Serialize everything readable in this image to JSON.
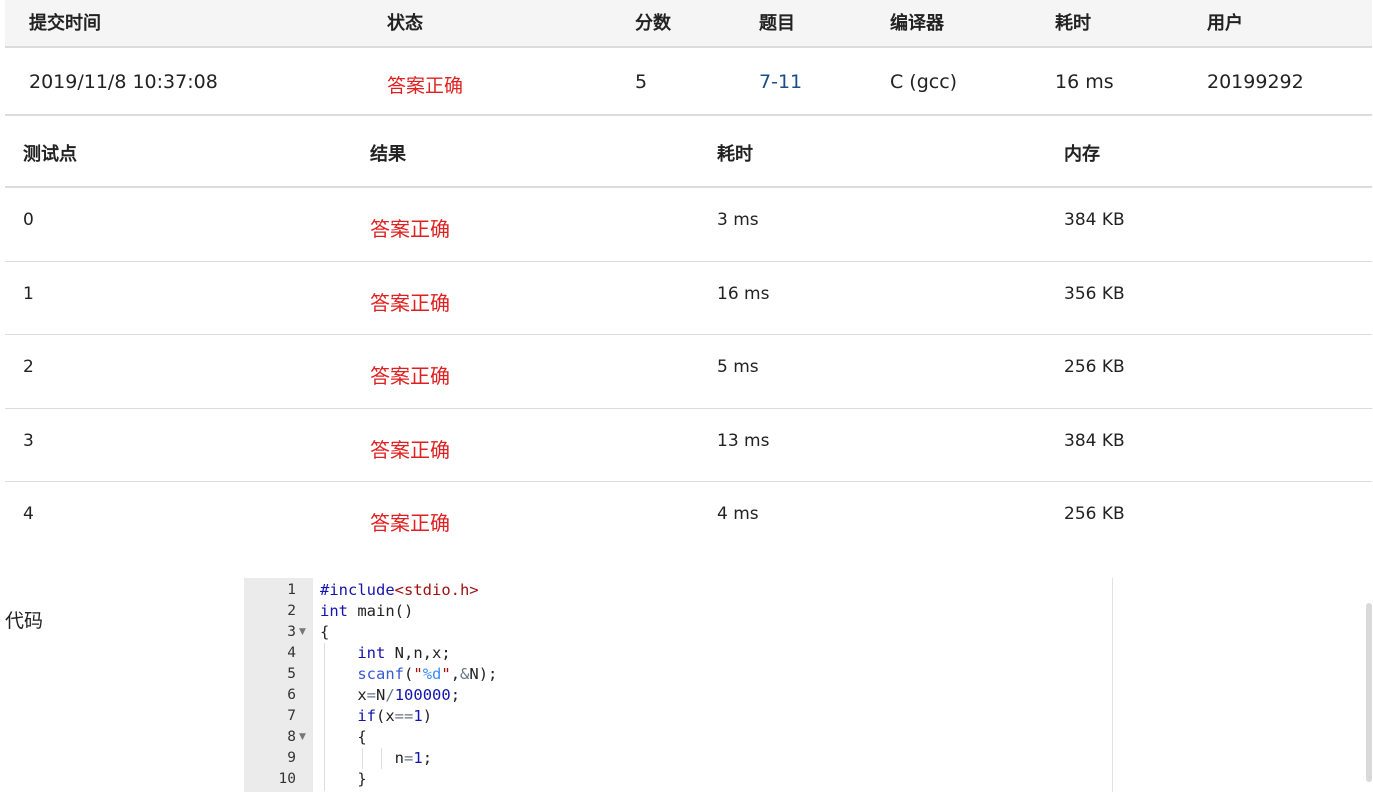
{
  "submission": {
    "headers": [
      "提交时间",
      "状态",
      "分数",
      "题目",
      "编译器",
      "耗时",
      "用户"
    ],
    "row": {
      "time": "2019/11/8 10:37:08",
      "status": "答案正确",
      "score": "5",
      "problem": "7-11",
      "compiler": "C (gcc)",
      "duration": "16 ms",
      "user": "20199292"
    }
  },
  "cases": {
    "headers": [
      "测试点",
      "结果",
      "耗时",
      "内存"
    ],
    "rows": [
      {
        "id": "0",
        "result": "答案正确",
        "time": "3 ms",
        "memory": "384 KB"
      },
      {
        "id": "1",
        "result": "答案正确",
        "time": "16 ms",
        "memory": "356 KB"
      },
      {
        "id": "2",
        "result": "答案正确",
        "time": "5 ms",
        "memory": "256 KB"
      },
      {
        "id": "3",
        "result": "答案正确",
        "time": "13 ms",
        "memory": "384 KB"
      },
      {
        "id": "4",
        "result": "答案正确",
        "time": "4 ms",
        "memory": "256 KB"
      }
    ]
  },
  "code": {
    "label": "代码",
    "line_numbers": [
      "1",
      "2",
      "3",
      "4",
      "5",
      "6",
      "7",
      "8",
      "9",
      "10"
    ],
    "folded_lines": [
      "3",
      "8"
    ],
    "lines": [
      "#include<stdio.h>",
      "int main()",
      "{",
      "    int N,n,x;",
      "    scanf(\"%d\",&N);",
      "    x=N/100000;",
      "    if(x==1)",
      "    {",
      "        n=1;",
      "    }"
    ]
  },
  "colors": {
    "accepted": "#e02020",
    "link": "#1a4e8a",
    "keyword": "#1414b0"
  }
}
